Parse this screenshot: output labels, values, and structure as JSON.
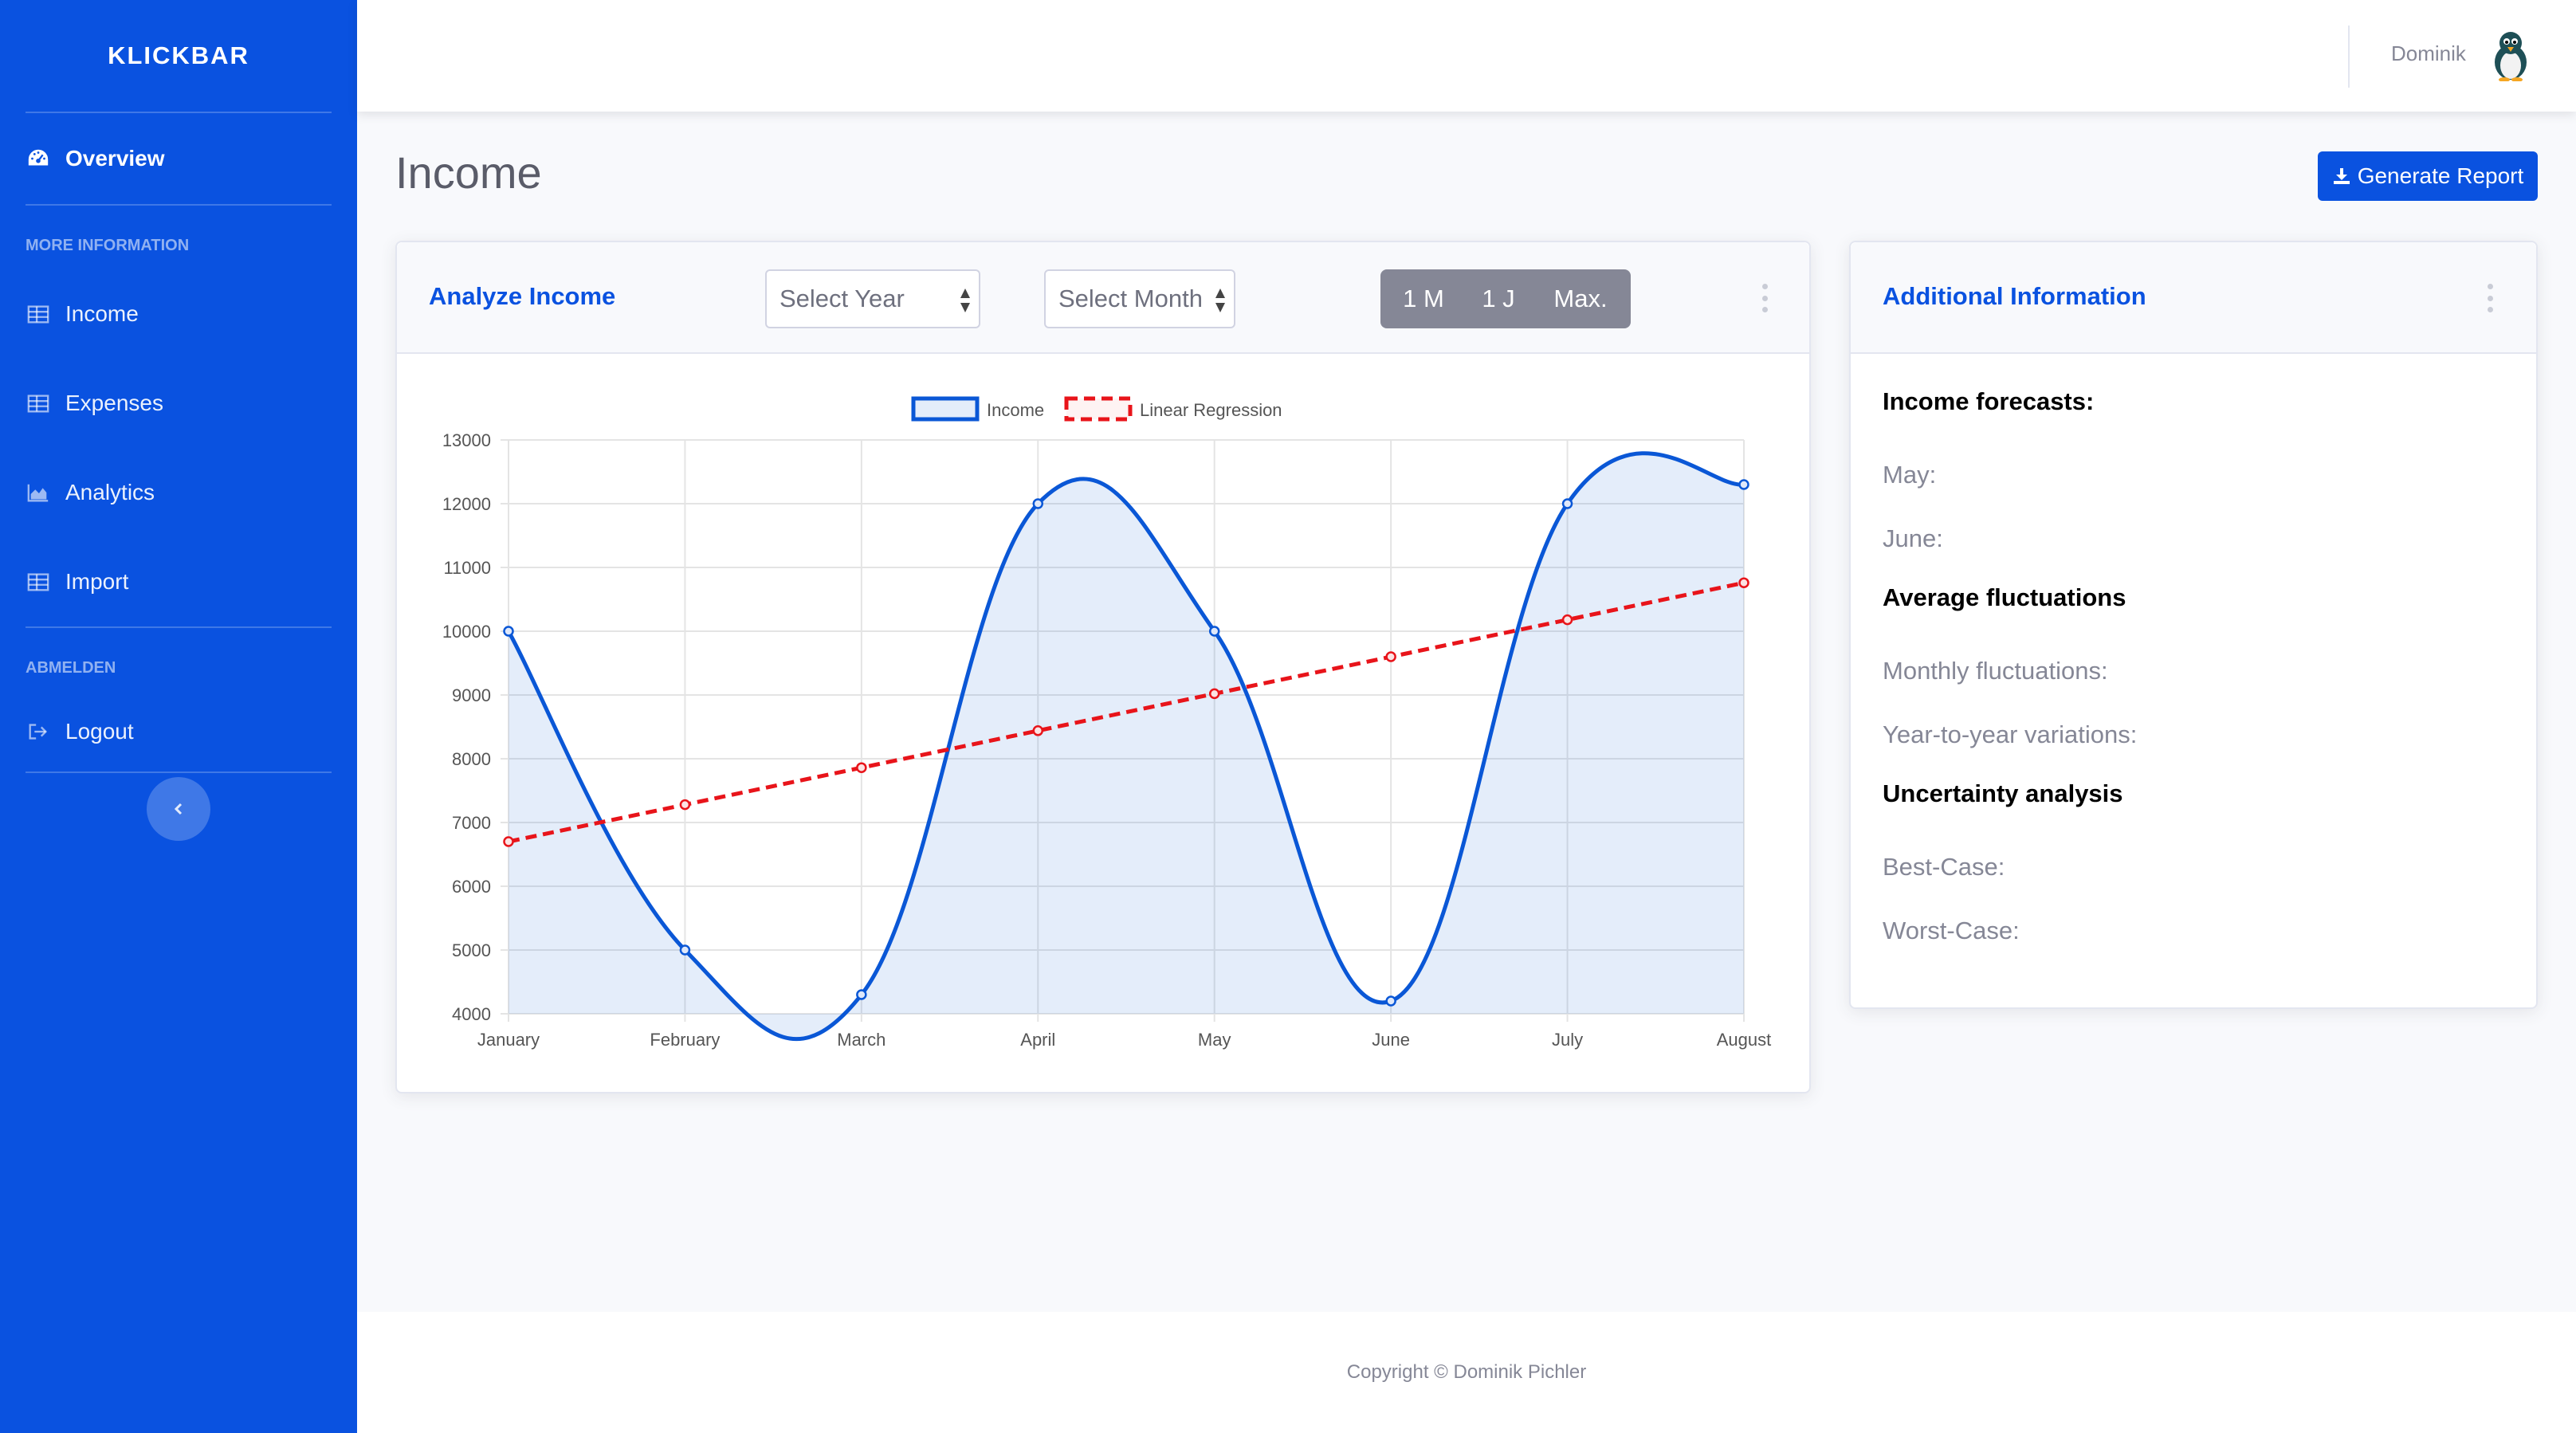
{
  "sidebar": {
    "brand": "KLICKBAR",
    "overview": "Overview",
    "heading_more": "MORE INFORMATION",
    "items": [
      {
        "label": "Income",
        "icon": "table-icon"
      },
      {
        "label": "Expenses",
        "icon": "table-icon"
      },
      {
        "label": "Analytics",
        "icon": "area-chart-icon"
      },
      {
        "label": "Import",
        "icon": "table-icon"
      }
    ],
    "heading_logout": "ABMELDEN",
    "logout": "Logout"
  },
  "topbar": {
    "username": "Dominik"
  },
  "page": {
    "title": "Income",
    "generate_report": "Generate Report"
  },
  "analyze": {
    "title": "Analyze Income",
    "select_year": "Select Year",
    "select_month": "Select Month",
    "ranges": [
      "1 M",
      "1 J",
      "Max."
    ]
  },
  "additional": {
    "title": "Additional Information",
    "forecasts_heading": "Income forecasts:",
    "may": "May:",
    "june": "June:",
    "fluctuations_heading": "Average fluctuations",
    "monthly": "Monthly fluctuations:",
    "yearly": "Year-to-year variations:",
    "uncertainty_heading": "Uncertainty analysis",
    "best": "Best-Case:",
    "worst": "Worst-Case:"
  },
  "footer": {
    "copyright": "Copyright © Dominik Pichler"
  },
  "colors": {
    "brand": "#0a52e0",
    "income": "#0a57d6",
    "regression": "#e8141a"
  },
  "chart_data": {
    "type": "line",
    "categories": [
      "January",
      "February",
      "March",
      "April",
      "May",
      "June",
      "July",
      "August"
    ],
    "series": [
      {
        "name": "Income",
        "values": [
          10000,
          5000,
          4300,
          12000,
          10000,
          4200,
          12000,
          12300
        ],
        "fill": true,
        "style": "solid"
      },
      {
        "name": "Linear Regression",
        "values": [
          6700,
          7280,
          7860,
          8440,
          9020,
          9600,
          10180,
          10760
        ],
        "fill": false,
        "style": "dashed"
      }
    ],
    "ylim": [
      4000,
      13000
    ],
    "yticks": [
      4000,
      5000,
      6000,
      7000,
      8000,
      9000,
      10000,
      11000,
      12000,
      13000
    ],
    "legend": "top",
    "grid": true
  }
}
